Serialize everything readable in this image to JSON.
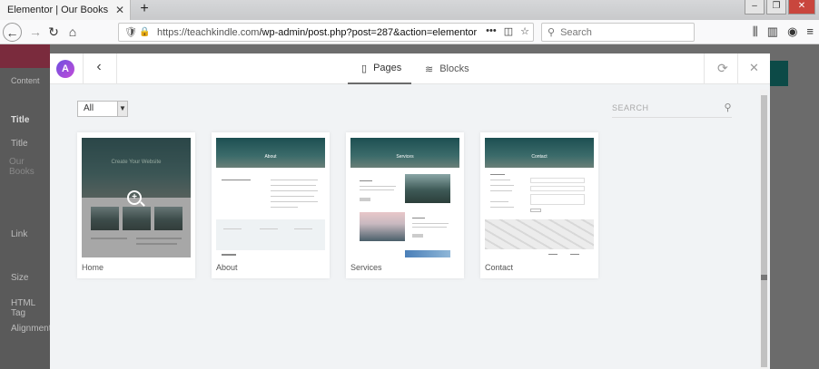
{
  "browser": {
    "tab_title": "Elementor | Our Books",
    "tab_close": "✕",
    "new_tab": "+",
    "url_domain": "https://teachkindle.com",
    "url_path": "/wp-admin/post.php?post=287&action=elementor",
    "search_placeholder": "Search",
    "more": "•••"
  },
  "background": {
    "items": [
      "Content",
      "Title",
      "Title",
      "Link",
      "Size",
      "HTML Tag",
      "Alignment"
    ],
    "textarea_value": "Our Books"
  },
  "modal": {
    "logo": "A",
    "tabs": [
      {
        "label": "Pages",
        "active": true
      },
      {
        "label": "Blocks",
        "active": false
      }
    ],
    "filter_value": "All",
    "search_placeholder": "SEARCH",
    "cards": [
      {
        "label": "Home",
        "hero_text": "Create Your Website"
      },
      {
        "label": "About",
        "hero_text": "About"
      },
      {
        "label": "Services",
        "hero_text": "Services"
      },
      {
        "label": "Contact",
        "hero_text": "Contact"
      }
    ]
  },
  "colors": {
    "accent_logo_start": "#6d4ee0",
    "accent_logo_end": "#c24dd8",
    "elementor_header": "#7a2b3d",
    "teal_banner": "#1d4f52"
  }
}
